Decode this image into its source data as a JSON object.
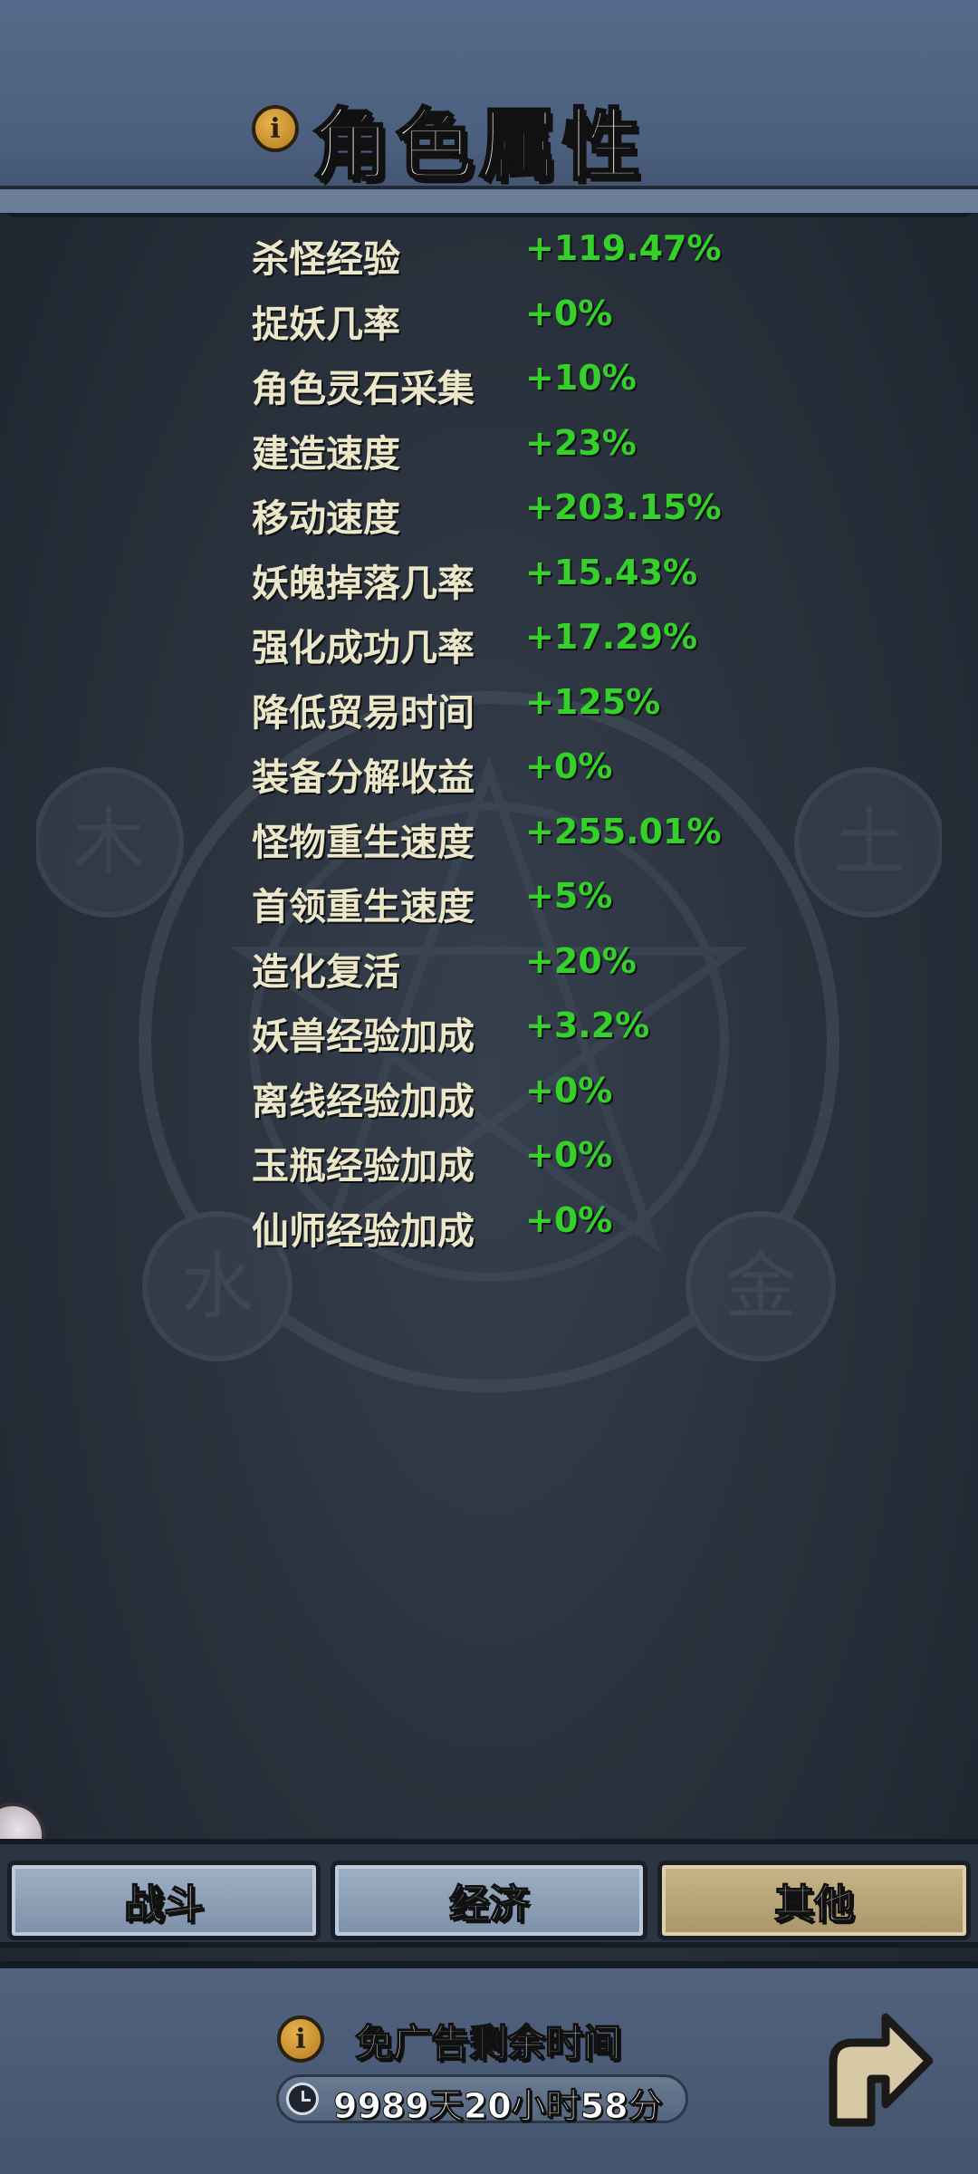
{
  "header": {
    "title": "角色属性",
    "info_icon": "info-icon"
  },
  "attributes": [
    {
      "label": "杀怪经验",
      "value": "+119.47%"
    },
    {
      "label": "捉妖几率",
      "value": "+0%"
    },
    {
      "label": "角色灵石采集",
      "value": "+10%"
    },
    {
      "label": "建造速度",
      "value": "+23%"
    },
    {
      "label": "移动速度",
      "value": "+203.15%"
    },
    {
      "label": "妖魄掉落几率",
      "value": "+15.43%"
    },
    {
      "label": "强化成功几率",
      "value": "+17.29%"
    },
    {
      "label": "降低贸易时间",
      "value": "+125%"
    },
    {
      "label": "装备分解收益",
      "value": "+0%"
    },
    {
      "label": "怪物重生速度",
      "value": "+255.01%"
    },
    {
      "label": "首领重生速度",
      "value": "+5%"
    },
    {
      "label": "造化复活",
      "value": "+20%"
    },
    {
      "label": "妖兽经验加成",
      "value": "+3.2%"
    },
    {
      "label": "离线经验加成",
      "value": "+0%"
    },
    {
      "label": "玉瓶经验加成",
      "value": "+0%"
    },
    {
      "label": "仙师经验加成",
      "value": "+0%"
    }
  ],
  "background": {
    "elements": [
      "木",
      "土",
      "水",
      "金"
    ]
  },
  "tabs": [
    {
      "label": "战斗",
      "active": false
    },
    {
      "label": "经济",
      "active": false
    },
    {
      "label": "其他",
      "active": true
    }
  ],
  "ad_free": {
    "title": "免广告剩余时间",
    "remaining": "9989天20小时58分",
    "info_icon": "info-icon",
    "clock_icon": "clock-icon"
  },
  "back_button": {
    "icon": "return-arrow-icon"
  },
  "colors": {
    "value_green": "#35d02a",
    "label_cream": "#ece7c8",
    "panel_blue": "#4b5f7e",
    "tab_active": "#c8b68a",
    "tab_inactive": "#9eb0c4"
  }
}
